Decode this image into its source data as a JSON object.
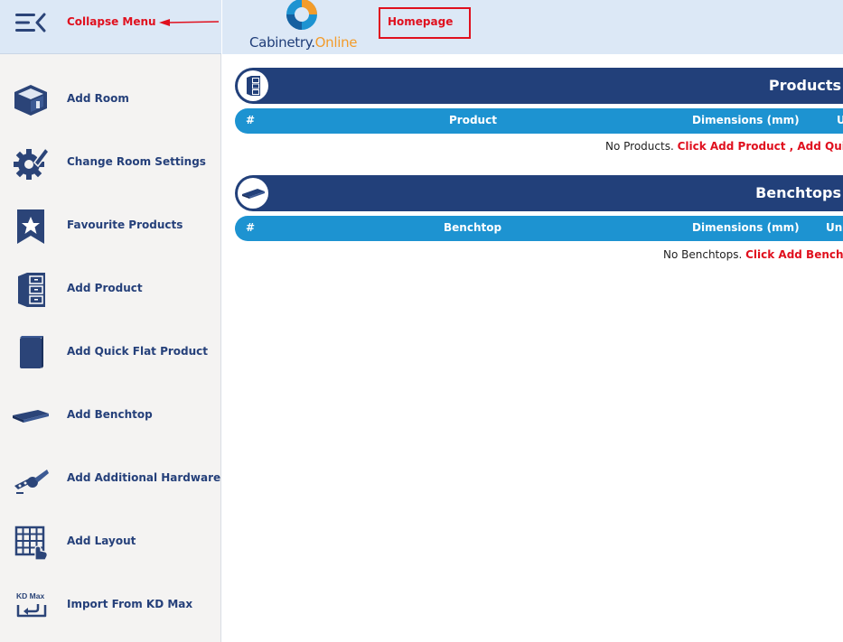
{
  "sidebar": {
    "collapse_label": "Collapse Menu",
    "items": [
      {
        "label": "Add Room",
        "icon": "room-box-icon"
      },
      {
        "label": "Change Room Settings",
        "icon": "gear-pencil-icon"
      },
      {
        "label": "Favourite Products",
        "icon": "bookmark-star-icon"
      },
      {
        "label": "Add Product",
        "icon": "cabinet-icon"
      },
      {
        "label": "Add Quick Flat Product",
        "icon": "flat-panel-icon"
      },
      {
        "label": "Add Benchtop",
        "icon": "benchtop-icon"
      },
      {
        "label": "Add Additional Hardware",
        "icon": "hinge-icon"
      },
      {
        "label": "Add Layout",
        "icon": "grid-hand-icon"
      },
      {
        "label": "Import From KD Max",
        "icon": "kdmax-import-icon"
      }
    ],
    "kdmax_icon_text": "KD Max"
  },
  "header": {
    "logo_main": "Cabinetry",
    "logo_dot": ".",
    "logo_suffix": "Online",
    "homepage_label": "Homepage"
  },
  "products": {
    "title": "Products",
    "columns": [
      "#",
      "Product",
      "Dimensions (mm)",
      "U"
    ],
    "empty_text": "No Products. ",
    "empty_link": "Click Add Product , Add Quick"
  },
  "benchtops": {
    "title": "Benchtops",
    "columns": [
      "#",
      "Benchtop",
      "Dimensions (mm)",
      "Uni"
    ],
    "empty_text": "No Benchtops. ",
    "empty_link": "Click Add BenchT"
  },
  "colors": {
    "navy": "#22407a",
    "blue": "#1d93d1",
    "red": "#e0101e",
    "sidebar_bg": "#f4f3f2",
    "header_bg": "#dce8f6"
  }
}
